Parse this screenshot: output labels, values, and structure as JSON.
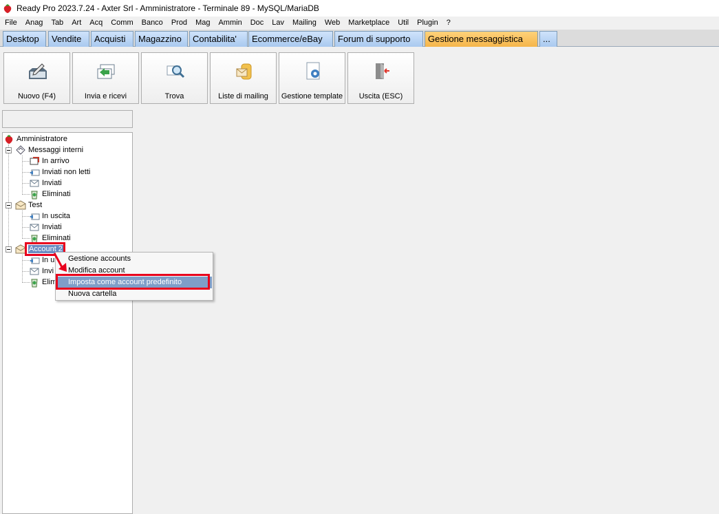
{
  "window": {
    "title": "Ready Pro 2023.7.24 - Axter Srl - Amministratore - Terminale 89 - MySQL/MariaDB",
    "app_icon": "strawberry-icon"
  },
  "menubar": {
    "items": [
      "File",
      "Anag",
      "Tab",
      "Art",
      "Acq",
      "Comm",
      "Banco",
      "Prod",
      "Mag",
      "Ammin",
      "Doc",
      "Lav",
      "Mailing",
      "Web",
      "Marketplace",
      "Util",
      "Plugin",
      "?"
    ]
  },
  "tabs": {
    "items": [
      "Desktop",
      "Vendite",
      "Acquisti",
      "Magazzino",
      "Contabilita'",
      "Ecommerce/eBay",
      "Forum di supporto",
      "Gestione messaggistica",
      "..."
    ],
    "active": "Gestione messaggistica"
  },
  "toolbar": {
    "buttons": [
      {
        "label": "Nuovo (F4)",
        "icon": "new-message-icon"
      },
      {
        "label": "Invia e ricevi",
        "icon": "send-receive-icon"
      },
      {
        "label": "Trova",
        "icon": "find-icon"
      },
      {
        "label": "Liste di mailing",
        "icon": "mailing-list-icon"
      },
      {
        "label": "Gestione template",
        "icon": "template-icon"
      },
      {
        "label": "Uscita (ESC)",
        "icon": "exit-icon"
      }
    ]
  },
  "search": {
    "value": ""
  },
  "tree": {
    "root": "Amministratore",
    "groups": [
      {
        "label": "Messaggi interni",
        "children": [
          "In arrivo",
          "Inviati non letti",
          "Inviati",
          "Eliminati"
        ]
      },
      {
        "label": "Test",
        "children": [
          "In uscita",
          "Inviati",
          "Eliminati"
        ]
      },
      {
        "label": "Account 2",
        "children": [
          "In u",
          "Invi",
          "Elim"
        ]
      }
    ]
  },
  "context_menu": {
    "items": [
      "Gestione accounts",
      "Modifica account",
      "Imposta come account predefinito",
      "Nuova cartella"
    ],
    "highlighted": "Imposta come account predefinito"
  },
  "colors": {
    "highlight_red": "#e8001c",
    "menu_hover": "#7f9ec8",
    "active_tab": "#f5b54a",
    "tab": "#a9c9ef"
  }
}
